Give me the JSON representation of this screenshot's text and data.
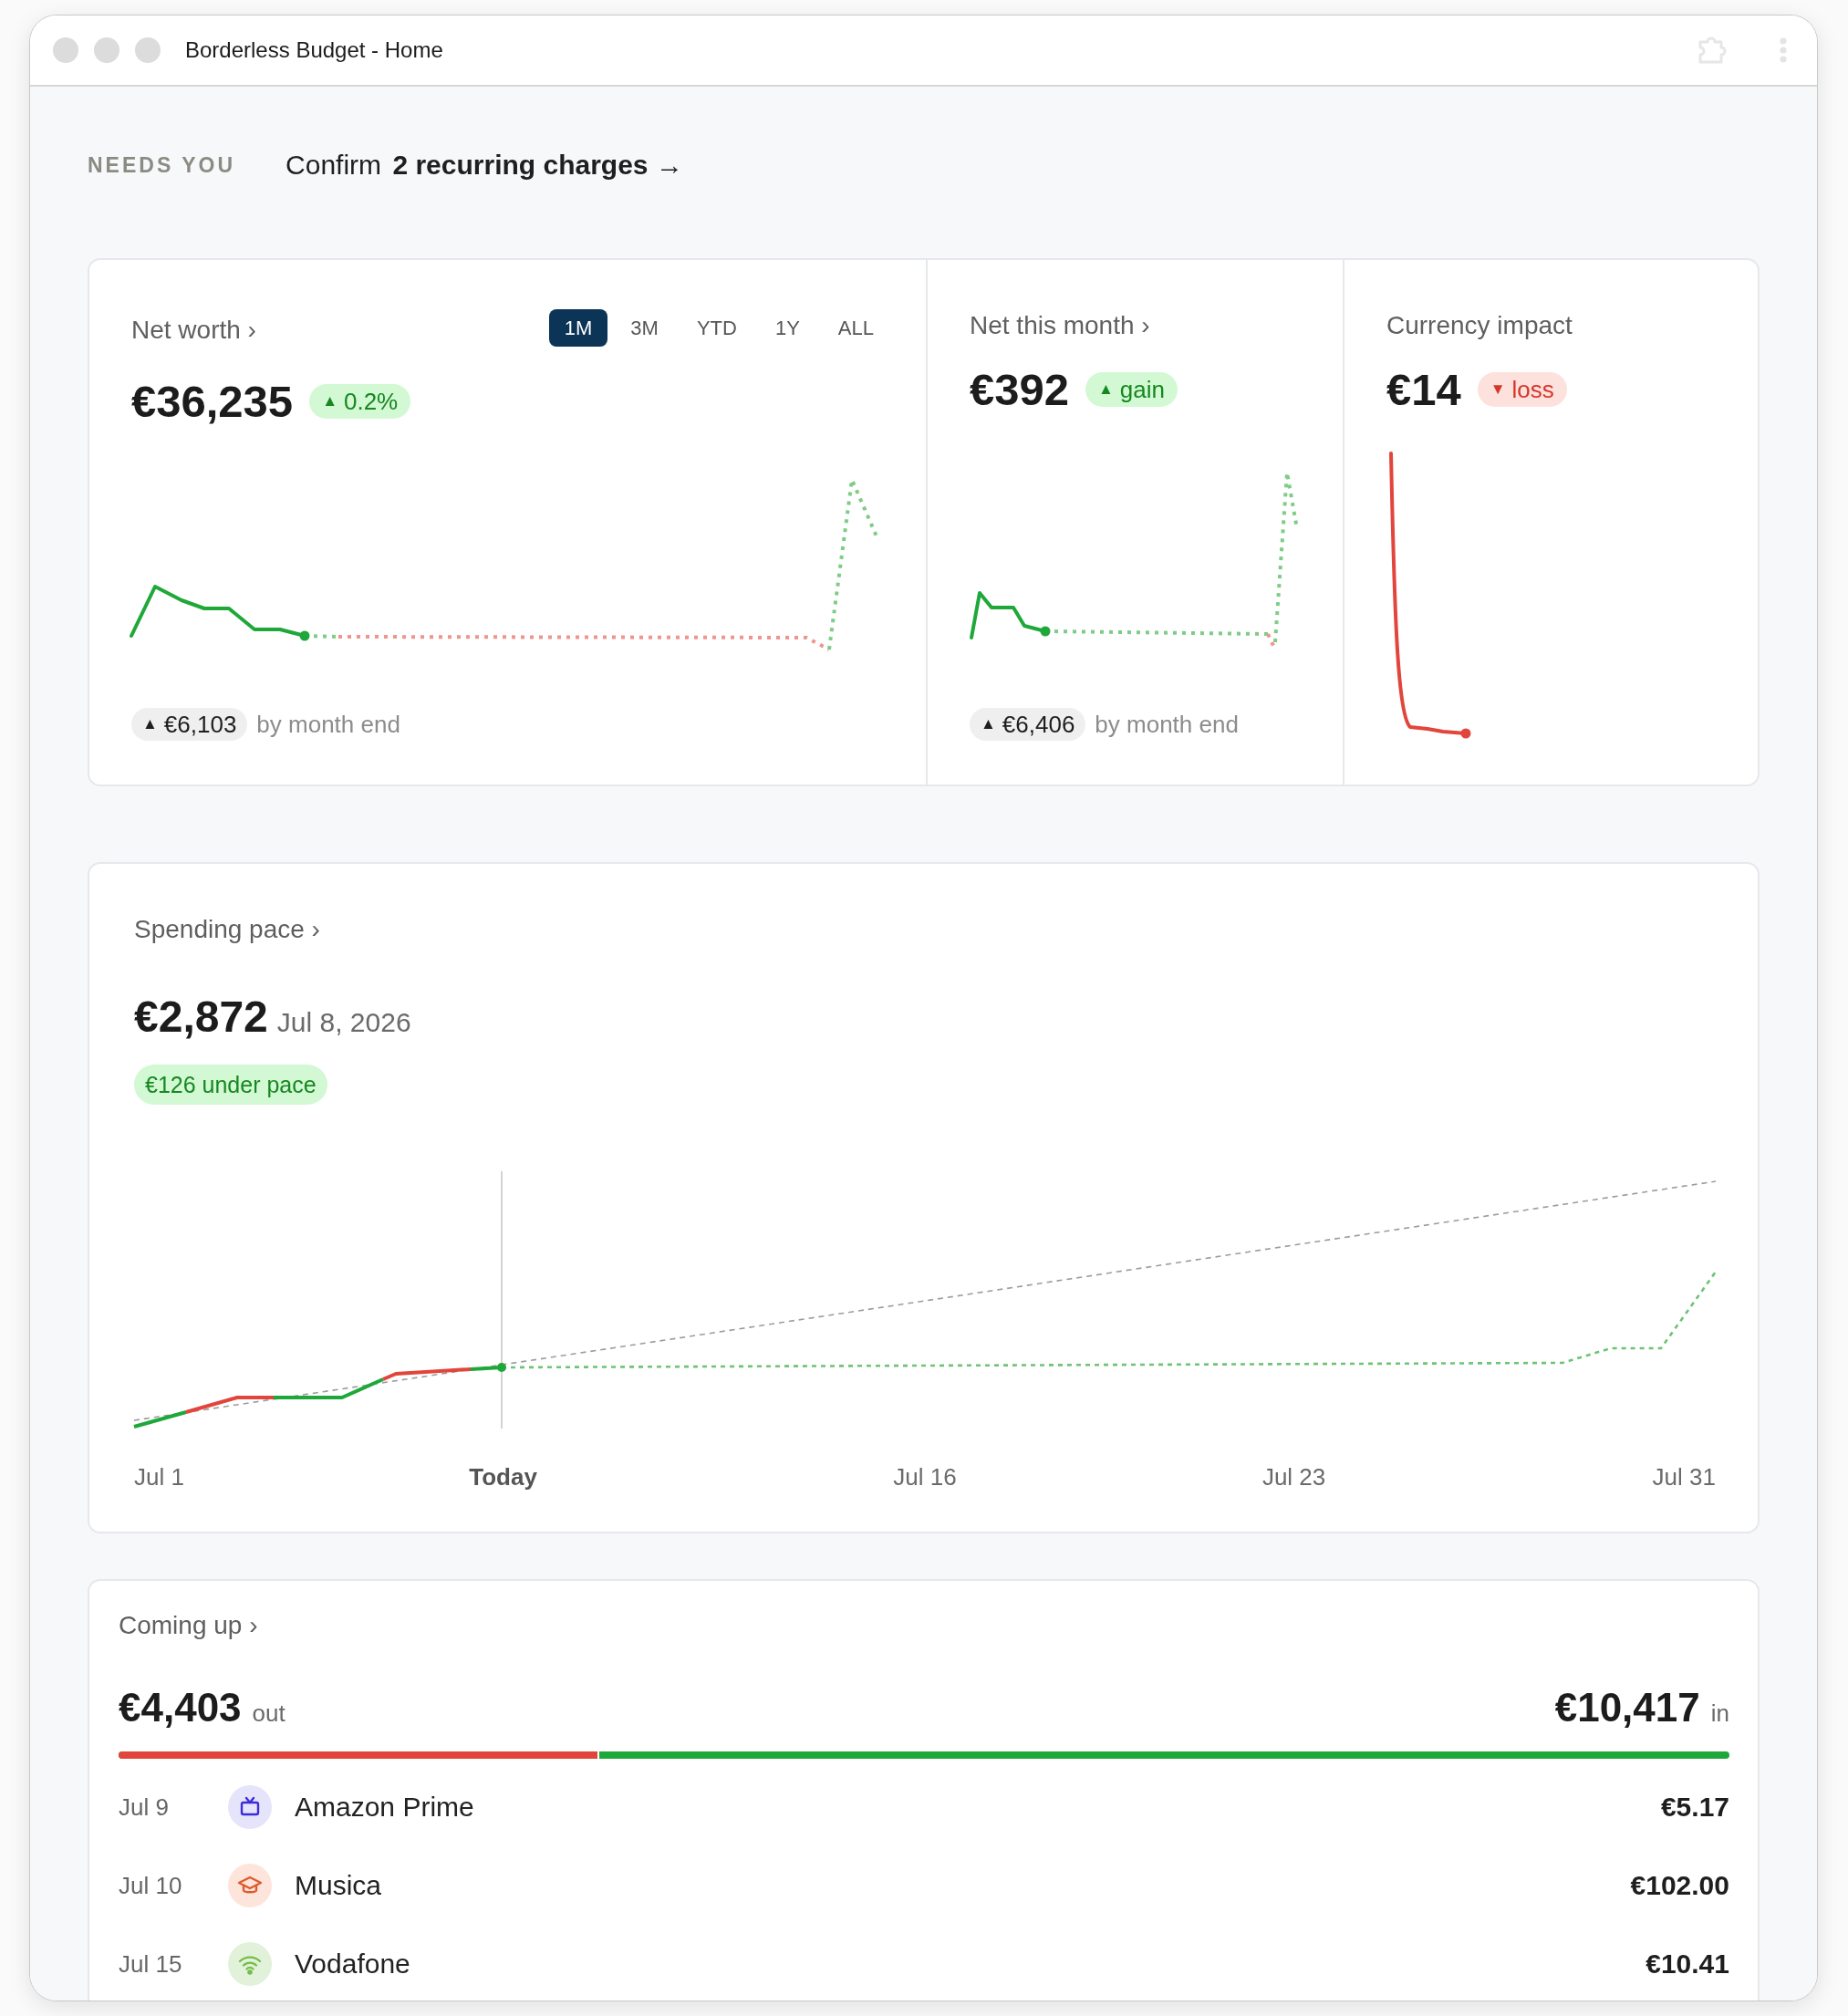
{
  "window": {
    "title": "Borderless Budget - Home"
  },
  "needs_you": {
    "label": "NEEDS YOU",
    "action": "Confirm **2 recurring charges** →"
  },
  "overview": {
    "panels": [
      {
        "kind": "networth",
        "title": "Net worth ›",
        "value": "€36,235",
        "badge": {
          "symbol": "▲",
          "text": "0.2%",
          "kind": "positive"
        },
        "ranges": [
          {
            "label": "1M",
            "selected": true
          },
          {
            "label": "3M",
            "selected": false
          },
          {
            "label": "YTD",
            "selected": false
          },
          {
            "label": "1Y",
            "selected": false
          },
          {
            "label": "ALL",
            "selected": false
          }
        ],
        "forecast": {
          "symbol": "▲",
          "amount": "€6,103",
          "caption": "by month end"
        }
      },
      {
        "kind": "monthly",
        "title": "Net this month ›",
        "value": "€392",
        "badge": {
          "symbol": "▲",
          "text": "gain",
          "kind": "positive"
        },
        "forecast": {
          "symbol": "▲",
          "amount": "€6,406",
          "caption": "by month end"
        }
      },
      {
        "kind": "currency",
        "title": "Currency impact",
        "value": "€14",
        "badge": {
          "symbol": "▼",
          "text": "loss",
          "kind": "negative"
        }
      }
    ]
  },
  "spending_pace": {
    "title": "Spending pace ›",
    "value": "€2,872",
    "date": "Jul 8, 2026",
    "badge": {
      "text": "€126 under pace",
      "kind": "positive"
    },
    "x_labels": [
      {
        "label": "Jul 1",
        "highlighted": false
      },
      {
        "label": "Today",
        "highlighted": true
      },
      {
        "label": "Jul 16",
        "highlighted": false
      },
      {
        "label": "Jul 23",
        "highlighted": false
      },
      {
        "label": "Jul 31",
        "highlighted": false
      }
    ]
  },
  "coming_up": {
    "title": "Coming up ›",
    "outflow": {
      "amount": "€4,403",
      "label": "out"
    },
    "inflow": {
      "amount": "€10,417",
      "label": "in"
    },
    "split": {
      "level": 0.297
    },
    "items": [
      {
        "date": "Jul 9",
        "name": "Amazon Prime",
        "amount": "€5.17",
        "kind": "streaming",
        "color": "#e6e4fb"
      },
      {
        "date": "Jul 10",
        "name": "Musica",
        "amount": "€102.00",
        "kind": "education",
        "color": "#fde5dc"
      },
      {
        "date": "Jul 15",
        "name": "Vodafone",
        "amount": "€10.41",
        "kind": "internet",
        "color": "#e2f1d9"
      }
    ]
  }
}
